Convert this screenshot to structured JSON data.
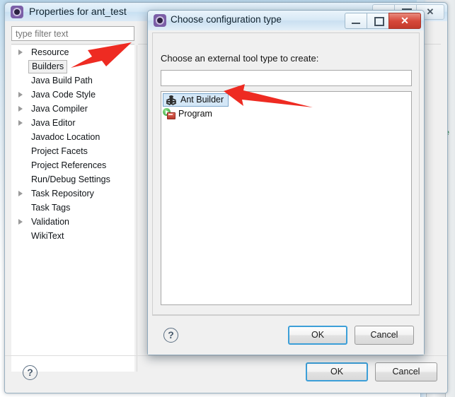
{
  "main_window": {
    "title": "Properties for ant_test",
    "icon": "eclipse-properties-icon",
    "controls": {
      "minimize": "Minimize",
      "maximize": "Maximize",
      "close": "Close"
    },
    "filter": {
      "placeholder": "type filter text",
      "value": ""
    },
    "tree": [
      {
        "label": "Resource",
        "expandable": true,
        "selected": false
      },
      {
        "label": "Builders",
        "expandable": false,
        "selected": true
      },
      {
        "label": "Java Build Path",
        "expandable": false,
        "selected": false
      },
      {
        "label": "Java Code Style",
        "expandable": true,
        "selected": false
      },
      {
        "label": "Java Compiler",
        "expandable": true,
        "selected": false
      },
      {
        "label": "Java Editor",
        "expandable": true,
        "selected": false
      },
      {
        "label": "Javadoc Location",
        "expandable": false,
        "selected": false
      },
      {
        "label": "Project Facets",
        "expandable": false,
        "selected": false
      },
      {
        "label": "Project References",
        "expandable": false,
        "selected": false
      },
      {
        "label": "Run/Debug Settings",
        "expandable": false,
        "selected": false
      },
      {
        "label": "Task Repository",
        "expandable": true,
        "selected": false
      },
      {
        "label": "Task Tags",
        "expandable": false,
        "selected": false
      },
      {
        "label": "Validation",
        "expandable": true,
        "selected": false
      },
      {
        "label": "WikiText",
        "expandable": false,
        "selected": false
      }
    ],
    "footer": {
      "help": "?",
      "ok_label": "OK",
      "cancel_label": "Cancel"
    }
  },
  "dialog": {
    "title": "Choose configuration type",
    "icon": "eclipse-dialog-icon",
    "controls": {
      "minimize": "Minimize",
      "maximize": "Maximize",
      "close": "Close"
    },
    "prompt": "Choose an external tool type to create:",
    "input": {
      "value": "",
      "placeholder": ""
    },
    "options": [
      {
        "label": "Ant Builder",
        "icon": "ant-icon",
        "selected": true
      },
      {
        "label": "Program",
        "icon": "program-icon",
        "selected": false
      }
    ],
    "footer": {
      "help": "?",
      "ok_label": "OK",
      "cancel_label": "Cancel"
    }
  },
  "annotations": {
    "arrow_color": "#ee2b22",
    "arrows": [
      {
        "name": "arrow-to-builders",
        "points_to": "Builders"
      },
      {
        "name": "arrow-to-ant-builder",
        "points_to": "Ant Builder"
      }
    ]
  },
  "colors": {
    "accent_focus": "#3c9fd8",
    "selection_blue": "#d4e7f7",
    "close_red": "#d6483a",
    "window_bg": "#f0f0f0"
  }
}
